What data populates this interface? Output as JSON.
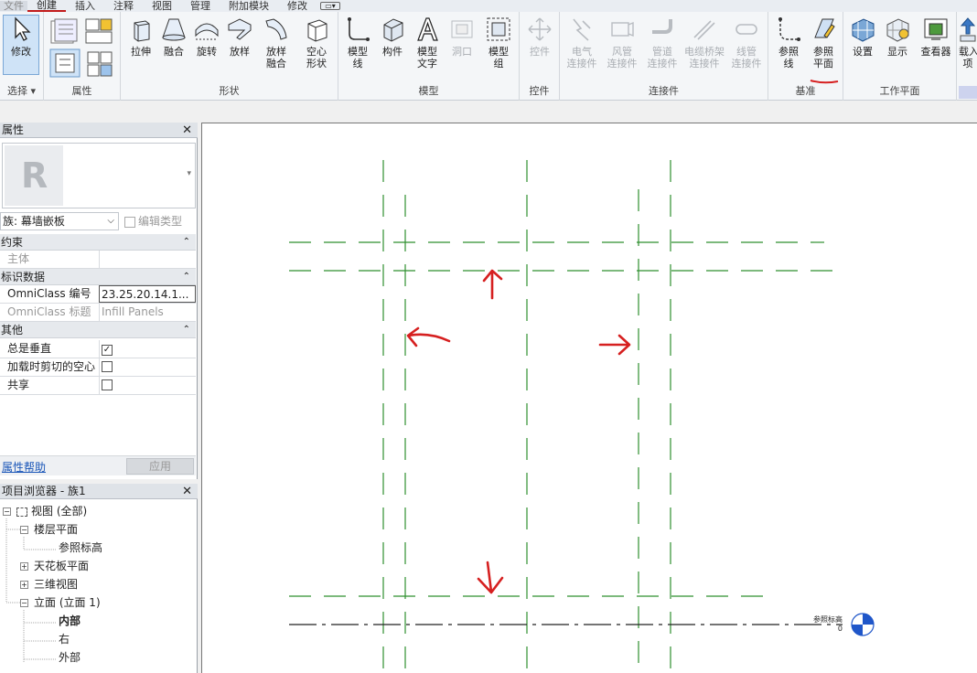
{
  "menu": {
    "items": [
      "文件",
      "创建",
      "插入",
      "注释",
      "视图",
      "管理",
      "附加模块",
      "修改"
    ],
    "active": "创建"
  },
  "ribbon": {
    "select_panel": {
      "tool": "修改",
      "label": "选择 ▾"
    },
    "properties_panel": {
      "label": "属性"
    },
    "forms_panel": {
      "label": "形状",
      "tools": [
        "拉伸",
        "融合",
        "旋转",
        "放样",
        "放样\n融合",
        "空心\n形状"
      ]
    },
    "model_panel": {
      "label": "模型",
      "tools": [
        "模型\n线",
        "构件",
        "模型\n文字",
        "洞口",
        "模型\n组"
      ]
    },
    "control_panel": {
      "label": "控件",
      "tools": [
        "控件"
      ]
    },
    "connectors_panel": {
      "label": "连接件",
      "tools": [
        "电气\n连接件",
        "风管\n连接件",
        "管道\n连接件",
        "电缆桥架\n连接件",
        "线管\n连接件"
      ]
    },
    "datum_panel": {
      "label": "基准",
      "tools": [
        "参照\n线",
        "参照\n平面"
      ]
    },
    "workplane_panel": {
      "label": "工作平面",
      "tools": [
        "设置",
        "显示",
        "查看器"
      ]
    },
    "load_panel": {
      "tools": [
        "载入\n项"
      ]
    }
  },
  "properties": {
    "title": "属性",
    "family_label": "族: 幕墙嵌板",
    "edit_type": "编辑类型",
    "sections": {
      "constraints": "约束",
      "identity": "标识数据",
      "other": "其他"
    },
    "rows": {
      "host": "主体",
      "omniclass_number": "OmniClass 编号",
      "omniclass_number_value": "23.25.20.14.1...",
      "omniclass_title": "OmniClass 标题",
      "omniclass_title_value": "Infill Panels",
      "always_vertical": "总是垂直",
      "cut_void": "加载时剪切的空心",
      "shared": "共享"
    },
    "always_vertical_checked": true,
    "cut_void_checked": false,
    "shared_checked": false,
    "help_link": "属性帮助",
    "apply": "应用"
  },
  "browser": {
    "title": "项目浏览器 - 族1",
    "views_all": "视图 (全部)",
    "floor_plans": "楼层平面",
    "ref_level": "参照标高",
    "ceiling_plans": "天花板平面",
    "views_3d": "三维视图",
    "elevations": "立面 (立面 1)",
    "interior": "内部",
    "right": "右",
    "exterior": "外部"
  },
  "canvas": {
    "level_name": "参照标高",
    "level_value": "0"
  },
  "colors": {
    "ref_plane": "#2f8f2f",
    "annotation": "#d62020",
    "level_marker": "#1f56c9"
  }
}
